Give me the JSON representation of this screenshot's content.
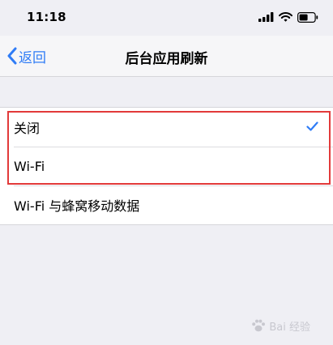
{
  "status_bar": {
    "time": "11:18"
  },
  "nav": {
    "back_label": "返回",
    "title": "后台应用刷新"
  },
  "options": [
    {
      "label": "关闭",
      "selected": true
    },
    {
      "label": "Wi-Fi",
      "selected": false
    },
    {
      "label": "Wi-Fi 与蜂窝移动数据",
      "selected": false
    }
  ],
  "watermark": {
    "text": "Bai 经验"
  },
  "colors": {
    "accent": "#2f7cf6",
    "highlight": "#e23a3a",
    "background": "#efeff4"
  },
  "icons": [
    "signal-icon",
    "wifi-icon",
    "battery-icon",
    "chevron-left-icon",
    "checkmark-icon",
    "paw-icon"
  ]
}
